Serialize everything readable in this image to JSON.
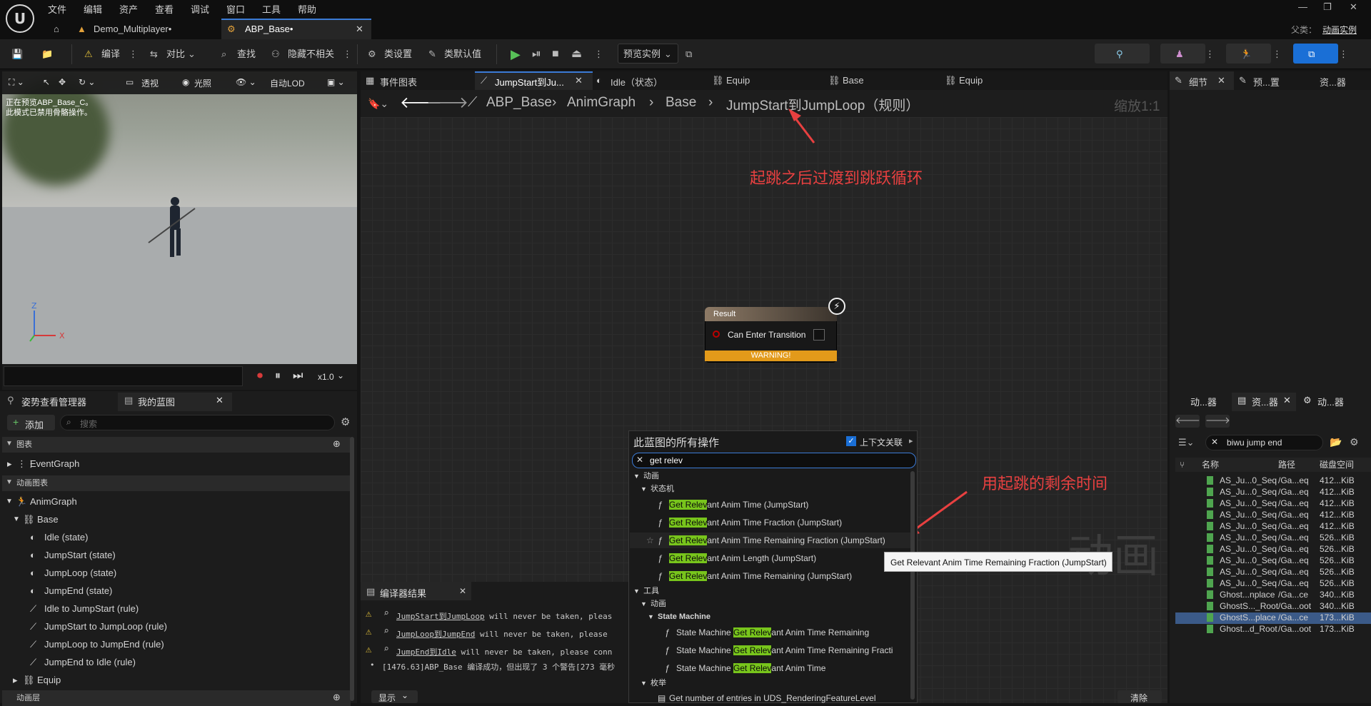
{
  "menu": [
    "文件",
    "编辑",
    "资产",
    "查看",
    "调试",
    "窗口",
    "工具",
    "帮助"
  ],
  "tabs": {
    "project": "Demo_Multiplayer•",
    "asset": "ABP_Base•"
  },
  "parent": {
    "label": "父类：",
    "value": "动画实例"
  },
  "toolbar": {
    "compile": "编译",
    "diff": "对比",
    "find": "查找",
    "hide": "隐藏不相关",
    "class_settings": "类设置",
    "class_defaults": "类默认值",
    "preview": "预览实例"
  },
  "viewport": {
    "perspective": "透视",
    "lit": "光照",
    "lod": "自动LOD",
    "info1": "正在预览ABP_Base_C。",
    "info2": "此模式已禁用骨骼操作。",
    "speed": "x1.0",
    "axis_z": "Z",
    "axis_x": "X"
  },
  "left": {
    "tab_pose": "姿势查看管理器",
    "tab_bp": "我的蓝图",
    "add": "添加",
    "search_ph": "搜索",
    "graphs_hdr": "图表",
    "eventgraph": "EventGraph",
    "animgraphs_hdr": "动画图表",
    "animgraph": "AnimGraph",
    "base": "Base",
    "items": [
      "Idle (state)",
      "JumpStart (state)",
      "JumpLoop (state)",
      "JumpEnd (state)",
      "Idle to JumpStart (rule)",
      "JumpStart to JumpLoop (rule)",
      "JumpLoop to JumpEnd (rule)",
      "JumpEnd to Idle (rule)"
    ],
    "equip": "Equip",
    "layers_hdr": "动画层"
  },
  "graphtabs": [
    "事件图表",
    "JumpStart到Ju...",
    "Idle（状态）",
    "Equip",
    "Base",
    "Equip"
  ],
  "breadcrumb": [
    "ABP_Base",
    "AnimGraph",
    "Base",
    "JumpStart到JumpLoop（规则）"
  ],
  "zoom": "缩放1:1",
  "annotation1": "起跳之后过渡到跳跃循环",
  "annotation2": "用起跳的剩余时间",
  "watermark": "动画",
  "node": {
    "title": "Result",
    "pin": "Can Enter Transition",
    "warning": "WARNING!"
  },
  "ctx": {
    "title": "此蓝图的所有操作",
    "context": "上下文关联",
    "query": "get relev",
    "cat_anim": "动画",
    "cat_sm": "状态机",
    "hl": "Get Relev",
    "items": [
      "ant Anim Time (JumpStart)",
      "ant Anim Time Fraction (JumpStart)",
      "ant Anim Time Remaining Fraction (JumpStart)",
      "ant Anim Length (JumpStart)",
      "ant Anim Time Remaining (JumpStart)"
    ],
    "cat_tools": "工具",
    "cat_anim2": "动画",
    "cat_smen": "State Machine",
    "sm_prefix": "State Machine ",
    "sm_items": [
      "ant Anim Time Remaining",
      "ant Anim Time Remaining Fracti",
      "ant Anim Time"
    ],
    "cat_enum": "枚举",
    "enum_item": "Get number of entries in UDS_RenderingFeatureLevel"
  },
  "tooltip": "Get Relevant Anim Time Remaining Fraction (JumpStart)",
  "compiler": {
    "title": "编译器结果",
    "l1a": "JumpStart到JumpLoop",
    "l1b": " will never be taken, pleas",
    "l2a": "JumpLoop到JumpEnd",
    "l2b": " will never be taken, please",
    "l3a": "JumpEnd到Idle",
    "l3b": " will never be taken, please conn",
    "l4": "[1476.63]ABP_Base 编译成功，但出现了 3 个警告[273 毫秒",
    "show": "显示",
    "clear": "清除"
  },
  "right": {
    "tabs": [
      "细节",
      "预...置",
      "资...器"
    ],
    "btabs": [
      "动...器",
      "资...器",
      "动...器"
    ],
    "search": "biwu jump end",
    "cols": [
      "名称",
      "路径",
      "磁盘空间"
    ],
    "assets": [
      [
        "AS_Ju...0_Seq",
        "/Ga...eq",
        "412...KiB"
      ],
      [
        "AS_Ju...0_Seq",
        "/Ga...eq",
        "412...KiB"
      ],
      [
        "AS_Ju...0_Seq",
        "/Ga...eq",
        "412...KiB"
      ],
      [
        "AS_Ju...0_Seq",
        "/Ga...eq",
        "412...KiB"
      ],
      [
        "AS_Ju...0_Seq",
        "/Ga...eq",
        "412...KiB"
      ],
      [
        "AS_Ju...0_Seq",
        "/Ga...eq",
        "526...KiB"
      ],
      [
        "AS_Ju...0_Seq",
        "/Ga...eq",
        "526...KiB"
      ],
      [
        "AS_Ju...0_Seq",
        "/Ga...eq",
        "526...KiB"
      ],
      [
        "AS_Ju...0_Seq",
        "/Ga...eq",
        "526...KiB"
      ],
      [
        "AS_Ju...0_Seq",
        "/Ga...eq",
        "526...KiB"
      ],
      [
        "Ghost...nplace",
        "/Ga...ce",
        "340...KiB"
      ],
      [
        "GhostS..._Root",
        "/Ga...oot",
        "340...KiB"
      ],
      [
        "GhostS...place",
        "/Ga...ce",
        "173...KiB"
      ],
      [
        "Ghost...d_Root",
        "/Ga...oot",
        "173...KiB"
      ]
    ]
  }
}
